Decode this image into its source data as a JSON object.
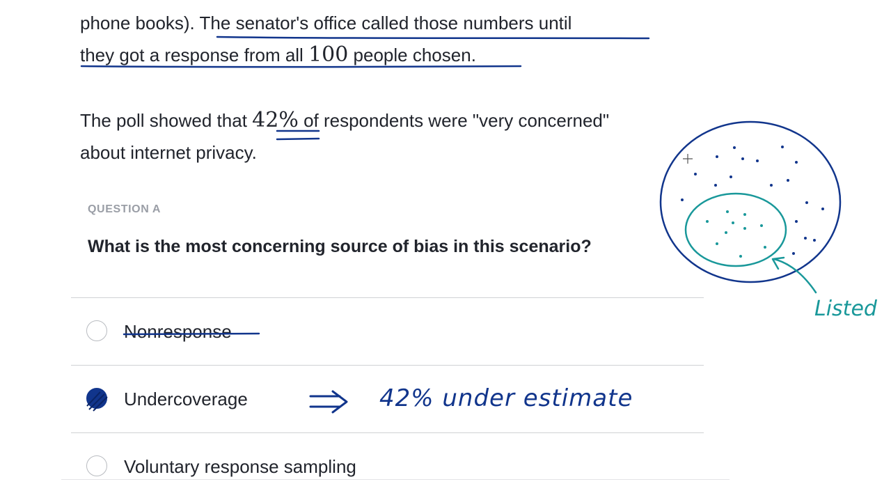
{
  "passage": {
    "line1_before": "phone books). ",
    "line1_underlined": "The senator's office called those numbers until",
    "line2_before": "they got a response from all ",
    "line2_number": "100",
    "line2_after": " people chosen.",
    "line3_before": "The poll showed that ",
    "line3_percent": "42%",
    "line3_after": " of respondents were \"very concerned\"",
    "line4": "about internet privacy."
  },
  "question": {
    "label": "QUESTION A",
    "text": "What is the most concerning source of bias in this scenario?"
  },
  "choices": [
    {
      "label": "Nonresponse",
      "selected": false
    },
    {
      "label": "Undercoverage",
      "selected": true
    },
    {
      "label": "Voluntary response sampling",
      "selected": false
    }
  ],
  "annotations": {
    "arrow_text": "⇒",
    "note": "42% under estimate",
    "circle_label": "Listed"
  },
  "colors": {
    "ink_blue": "#11358c",
    "ink_teal": "#19989a",
    "text": "#21242c",
    "muted": "#9a9ea6"
  }
}
